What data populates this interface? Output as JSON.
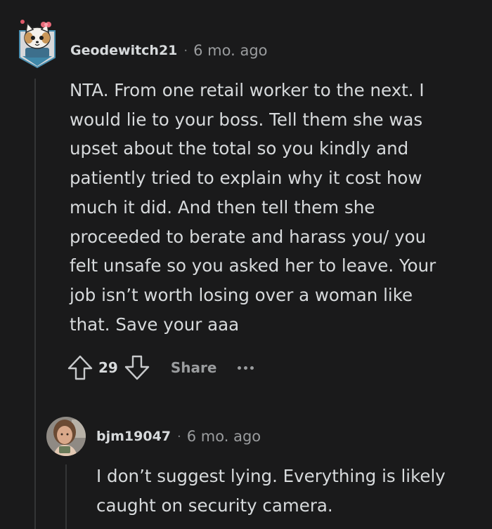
{
  "comments": [
    {
      "author": "Geodewitch21",
      "separator": "·",
      "age": "6 mo. ago",
      "avatar_icon": "cat-snoo-avatar-icon",
      "body": "NTA. From one retail worker to the next. I\nwould lie to your boss. Tell them she was\nupset about the total so you kindly and\npatiently tried to explain why it cost how\nmuch it did. And then tell them she\nproceeded to berate and harass you/ you\nfelt unsafe so you asked her to leave. Your\njob isn’t worth losing over a woman like\nthat. Save your aaa",
      "votes": "29",
      "share_label": "Share"
    },
    {
      "author": "bjm19047",
      "separator": "·",
      "age": "6 mo. ago",
      "avatar_icon": "user-photo-avatar-icon",
      "body": "I don’t suggest lying. Everything is likely\ncaught on security camera."
    }
  ],
  "colors": {
    "background": "#1a1a1b",
    "text": "#d7dadc",
    "muted": "#9a9c9e",
    "thread_line": "#343536"
  }
}
